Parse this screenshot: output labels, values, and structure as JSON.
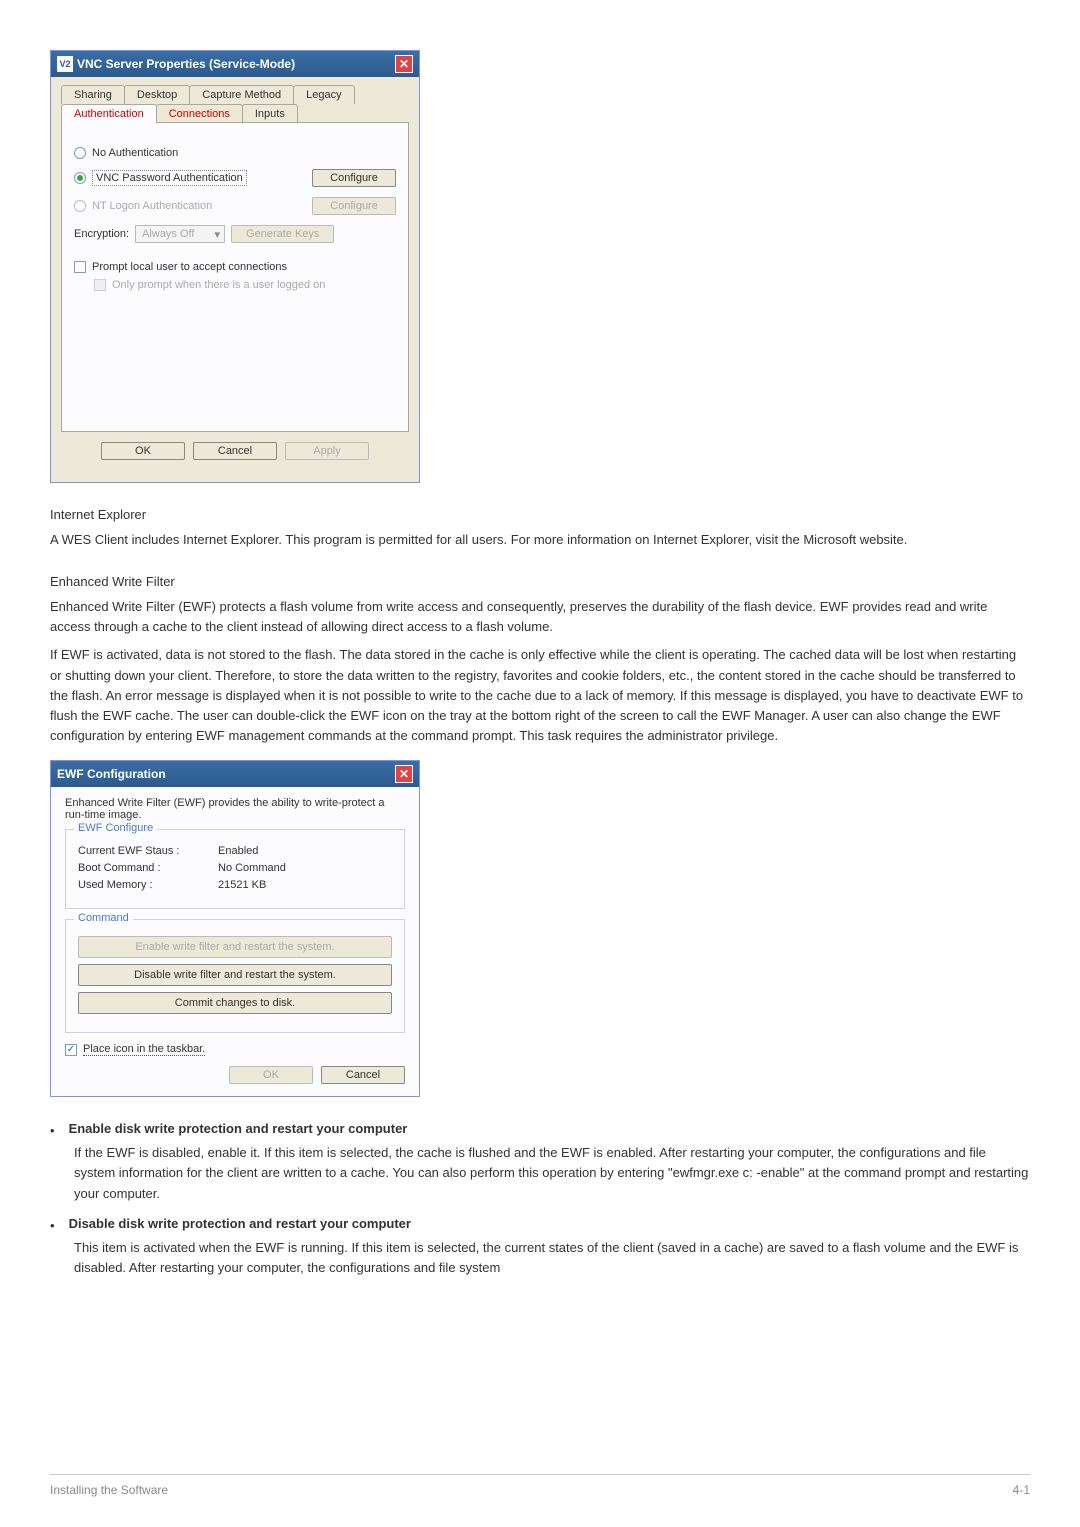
{
  "vnc": {
    "title": "VNC Server Properties (Service-Mode)",
    "icon_text": "V2",
    "tabs_row1": [
      "Sharing",
      "Desktop",
      "Capture Method",
      "Legacy"
    ],
    "tabs_row2": [
      "Authentication",
      "Connections",
      "Inputs"
    ],
    "active_tab": "Authentication",
    "radio_no_auth": "No Authentication",
    "radio_vnc_pass": "VNC Password Authentication",
    "radio_nt_logon": "NT Logon Authentication",
    "configure_btn": "Configure",
    "encryption_label": "Encryption:",
    "encryption_value": "Always Off",
    "generate_keys": "Generate Keys",
    "prompt_local": "Prompt local user to accept connections",
    "only_prompt": "Only prompt when there is a user logged on",
    "ok": "OK",
    "cancel": "Cancel",
    "apply": "Apply"
  },
  "doc": {
    "ie_title": "Internet Explorer",
    "ie_body": "A WES Client includes Internet Explorer. This program is permitted for all users. For more information on Internet Explorer, visit the Microsoft website.",
    "ewf_title": "Enhanced Write Filter",
    "ewf_p1": "Enhanced Write Filter (EWF) protects a flash volume from write access and consequently, preserves the durability of the flash device. EWF provides read and write access through a cache to the client instead of allowing direct access to a flash volume.",
    "ewf_p2": "If EWF is activated, data is not stored to the flash. The data stored in the cache is only effective while the client is operating. The cached data will be lost when restarting or shutting down your client. Therefore, to store the data written to the registry, favorites and cookie folders, etc., the content stored in the cache should be transferred to the flash.  An error message is displayed when it is not possible to write to the cache due to a lack of memory. If this message is displayed, you have to deactivate EWF to flush the EWF cache. The user can double-click the EWF icon on the tray at the bottom right of the screen to call the EWF Manager. A user can also change the EWF configuration by entering EWF management commands at the command prompt. This task requires the administrator privilege."
  },
  "ewf": {
    "title": "EWF Configuration",
    "desc": "Enhanced Write Filter (EWF) provides the ability to write-protect a run-time image.",
    "configure_legend": "EWF Configure",
    "staus_label": "Current EWF Staus :",
    "staus_value": "Enabled",
    "boot_label": "Boot Command :",
    "boot_value": "No Command",
    "mem_label": "Used Memory :",
    "mem_value": "21521 KB",
    "command_legend": "Command",
    "enable_btn": "Enable write filter and restart the system.",
    "disable_btn": "Disable write filter and restart the system.",
    "commit_btn": "Commit changes to disk.",
    "taskbar_check": "Place icon in the taskbar.",
    "ok": "OK",
    "cancel": "Cancel"
  },
  "bullets": {
    "b1_title": "Enable disk write protection and restart your computer",
    "b1_body": "If the EWF is disabled, enable it. If this item is selected, the cache is flushed and the EWF is enabled. After restarting your computer, the configurations and file system information for the client are written to a cache. You can also perform this operation by entering \"ewfmgr.exe c: -enable\" at the command prompt and restarting your computer.",
    "b2_title": "Disable disk write protection and restart your computer",
    "b2_body": "This item is activated when the EWF is running. If this item is selected, the current states of the client (saved in a cache) are saved to a flash volume and the EWF is disabled. After restarting your computer, the configurations and file system"
  },
  "footer": {
    "left": "Installing the Software",
    "right": "4-1"
  }
}
